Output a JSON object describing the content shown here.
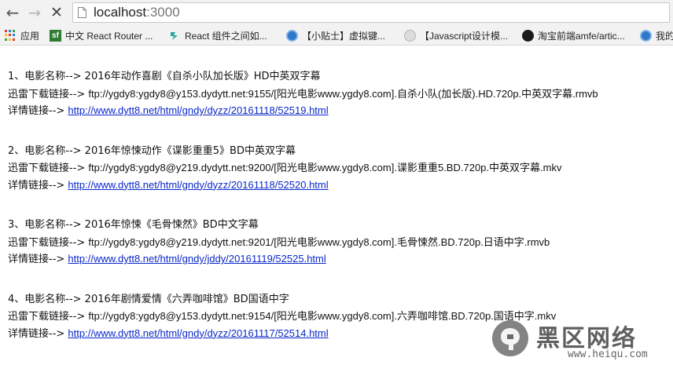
{
  "browser": {
    "url_host": "localhost",
    "url_port": ":3000",
    "icons": {
      "back": "back-arrow-icon",
      "forward": "forward-arrow-icon",
      "stop": "stop-x-icon",
      "page": "page-icon"
    }
  },
  "bookmarks": [
    {
      "label": "应用",
      "icon": "apps-grid-icon"
    },
    {
      "label": "中文 React Router ...",
      "icon": "sf-icon"
    },
    {
      "label": "React 组件之间如...",
      "icon": "react-icon"
    },
    {
      "label": "【小贴士】虚拟键...",
      "icon": "blue-globe-icon"
    },
    {
      "label": "【Javascript设计模...",
      "icon": "gray-globe-icon"
    },
    {
      "label": "淘宝前端amfe/artic...",
      "icon": "github-icon"
    },
    {
      "label": "我的",
      "icon": "blue-globe-icon"
    }
  ],
  "movies": [
    {
      "title": "1、电影名称--> 2016年动作喜剧《自杀小队加长版》HD中英双字幕",
      "download_label": "迅雷下载链接--> ",
      "download": "ftp://ygdy8:ygdy8@y153.dydytt.net:9155/[阳光电影www.ygdy8.com].自杀小队(加长版).HD.720p.中英双字幕.rmvb",
      "detail_label": "详情链接--> ",
      "detail_url": "http://www.dytt8.net/html/gndy/dyzz/20161118/52519.html"
    },
    {
      "title": "2、电影名称--> 2016年惊悚动作《谍影重重5》BD中英双字幕",
      "download_label": "迅雷下载链接--> ",
      "download": "ftp://ygdy8:ygdy8@y219.dydytt.net:9200/[阳光电影www.ygdy8.com].谍影重重5.BD.720p.中英双字幕.mkv",
      "detail_label": "详情链接--> ",
      "detail_url": "http://www.dytt8.net/html/gndy/dyzz/20161118/52520.html"
    },
    {
      "title": "3、电影名称--> 2016年惊悚《毛骨悚然》BD中文字幕",
      "download_label": "迅雷下载链接--> ",
      "download": "ftp://ygdy8:ygdy8@y219.dydytt.net:9201/[阳光电影www.ygdy8.com].毛骨悚然.BD.720p.日语中字.rmvb",
      "detail_label": "详情链接--> ",
      "detail_url": "http://www.dytt8.net/html/gndy/jddy/20161119/52525.html"
    },
    {
      "title": "4、电影名称--> 2016年剧情爱情《六弄咖啡馆》BD国语中字",
      "download_label": "迅雷下载链接--> ",
      "download": "ftp://ygdy8:ygdy8@y153.dydytt.net:9154/[阳光电影www.ygdy8.com].六弄咖啡馆.BD.720p.国语中字.mkv",
      "detail_label": "详情链接--> ",
      "detail_url": "http://www.dytt8.net/html/gndy/dyzz/20161117/52514.html"
    }
  ],
  "watermark": {
    "title": "黑区网络",
    "subtitle": "www.heiqu.com",
    "icon": "heiqu-logo-icon"
  }
}
